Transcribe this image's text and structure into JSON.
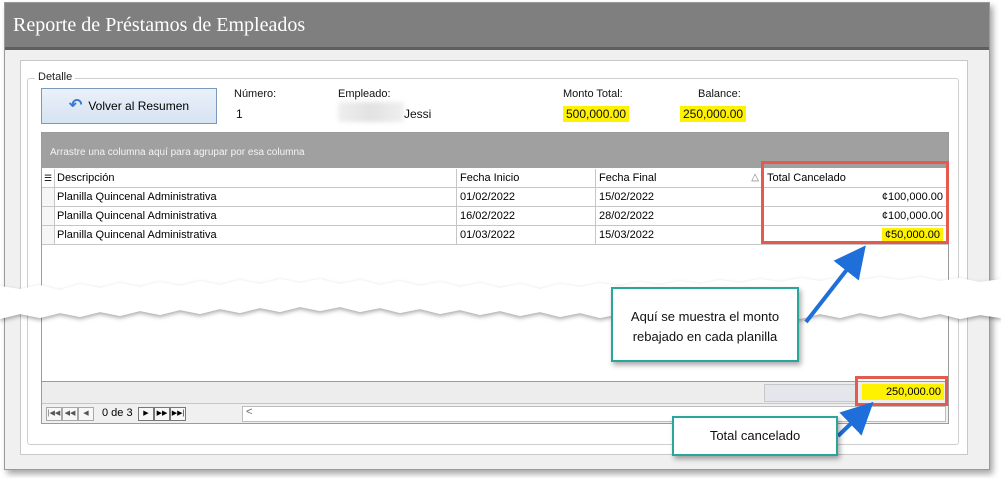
{
  "window": {
    "title": "Reporte de Préstamos de Empleados"
  },
  "group_label": "Detalle",
  "back_button": {
    "label": "Volver al Resumen",
    "icon": "undo-arrow-icon"
  },
  "fields": {
    "numero": {
      "label": "Número:",
      "value": "1"
    },
    "empleado": {
      "label": "Empleado:",
      "value": "Jessi"
    },
    "monto_total": {
      "label": "Monto Total:",
      "value": "500,000.00"
    },
    "balance": {
      "label": "Balance:",
      "value": "250,000.00"
    }
  },
  "grid": {
    "group_hint": "Arrastre una columna aquí para agrupar por esa columna",
    "columns": [
      "Descripción",
      "Fecha Inicio",
      "Fecha Final",
      "Total Cancelado"
    ],
    "rows": [
      [
        "Planilla Quincenal Administrativa",
        "01/02/2022",
        "15/02/2022",
        "¢100,000.00"
      ],
      [
        "Planilla Quincenal Administrativa",
        "16/02/2022",
        "28/02/2022",
        "¢100,000.00"
      ],
      [
        "Planilla Quincenal Administrativa",
        "01/03/2022",
        "15/03/2022",
        "¢50,000.00"
      ]
    ],
    "total": "250,000.00",
    "navigator": "0 de 3"
  },
  "callouts": {
    "row_note": "Aquí se muestra el monto rebajado en cada planilla",
    "total_note": "Total cancelado"
  },
  "colors": {
    "highlight": "#fff200",
    "annotation_red": "#e45a4f",
    "callout_border": "#29a59a",
    "arrow_blue": "#1e6fd9"
  }
}
